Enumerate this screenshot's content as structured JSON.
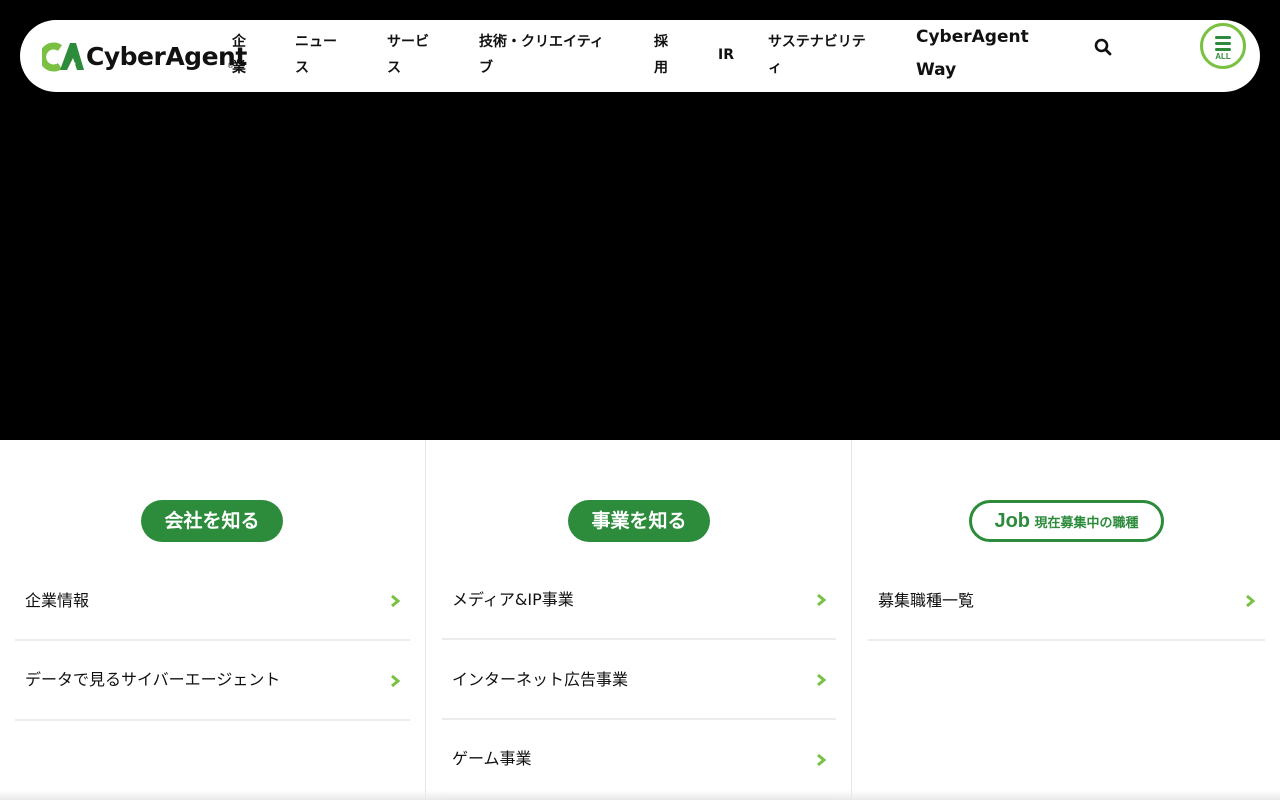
{
  "header": {
    "logo": {
      "text": "CyberAgent",
      "reg": "®"
    },
    "nav": [
      {
        "line1": "企",
        "line2": "業"
      },
      {
        "line1": "ニュー",
        "line2": "ス"
      },
      {
        "line1": "サービ",
        "line2": "ス"
      },
      {
        "line1": "技術・クリエイティ",
        "line2": "ブ"
      },
      {
        "line1": "採",
        "line2": "用"
      },
      {
        "line1": "IR"
      },
      {
        "line1": "サステナビリテ",
        "line2": "ィ"
      },
      {
        "line1": "CyberAgent",
        "line2": "Way"
      }
    ],
    "search_icon": "search-icon",
    "all_button": {
      "label": "ALL",
      "icon": "menu-icon"
    }
  },
  "sections": [
    {
      "pill": "会社を知る",
      "items": [
        "企業情報",
        "データで見るサイバーエージェント"
      ]
    },
    {
      "pill": "事業を知る",
      "items": [
        "メディア&IP事業",
        "インターネット広告事業",
        "ゲーム事業"
      ]
    },
    {
      "pill_big": "Job",
      "pill_small": " 現在募集中の職種",
      "items": [
        "募集職種一覧"
      ]
    }
  ],
  "colors": {
    "brand_green": "#2d8c3c",
    "accent_lime": "#7ac143",
    "background": "#000000"
  }
}
